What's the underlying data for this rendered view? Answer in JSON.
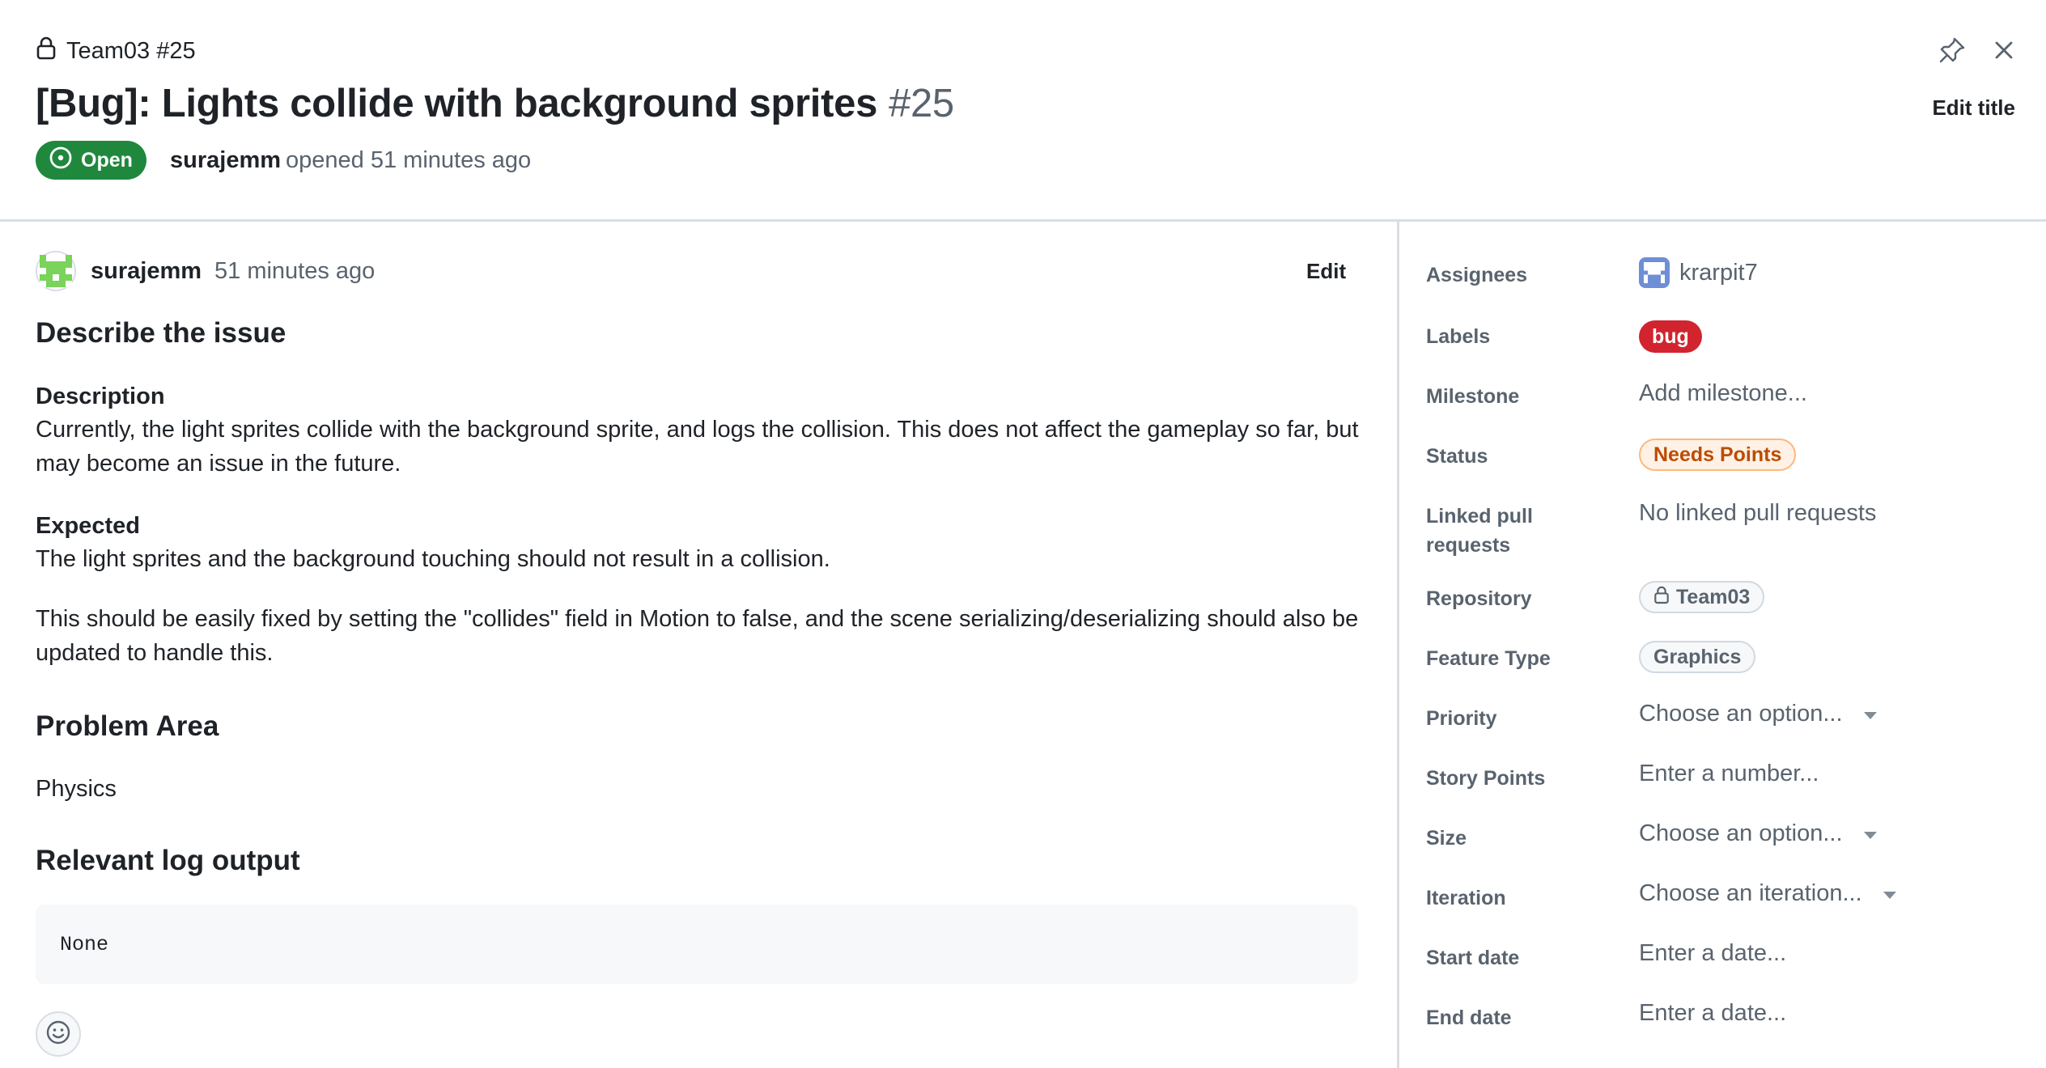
{
  "header": {
    "repo_ref": "Team03 #25",
    "title": "[Bug]: Lights collide with background sprites",
    "number": "#25",
    "state": "Open",
    "author": "surajemm",
    "opened_text": "opened 51 minutes ago",
    "edit_title": "Edit title"
  },
  "comment": {
    "author": "surajemm",
    "time": "51 minutes ago",
    "edit": "Edit"
  },
  "body": {
    "heading_describe": "Describe the issue",
    "description_label": "Description",
    "description_text": "Currently, the light sprites collide with the background sprite, and logs the collision. This does not affect the gameplay so far, but may become an issue in the future.",
    "expected_label": "Expected",
    "expected_text": "The light sprites and the background touching should not result in a collision.",
    "fix_text": "This should be easily fixed by setting the \"collides\" field in Motion to false, and the scene serializing/deserializing should also be updated to handle this.",
    "heading_problem_area": "Problem Area",
    "problem_area": "Physics",
    "heading_log": "Relevant log output",
    "log_output": "None"
  },
  "sidebar": {
    "assignees_label": "Assignees",
    "assignee": "krarpit7",
    "labels_label": "Labels",
    "label_bug": "bug",
    "milestone_label": "Milestone",
    "milestone_value": "Add milestone...",
    "status_label": "Status",
    "status_value": "Needs Points",
    "linked_label_line1": "Linked pull",
    "linked_label_line2": "requests",
    "linked_value": "No linked pull requests",
    "repository_label": "Repository",
    "repository_value": "Team03",
    "feature_type_label": "Feature Type",
    "feature_type_value": "Graphics",
    "priority_label": "Priority",
    "priority_value": "Choose an option...",
    "story_points_label": "Story Points",
    "story_points_value": "Enter a number...",
    "size_label": "Size",
    "size_value": "Choose an option...",
    "iteration_label": "Iteration",
    "iteration_value": "Choose an iteration...",
    "start_date_label": "Start date",
    "start_date_value": "Enter a date...",
    "end_date_label": "End date",
    "end_date_value": "Enter a date..."
  },
  "icons": [
    "lock-icon",
    "pin-icon",
    "close-icon",
    "issue-open-icon",
    "smiley-icon",
    "chevron-down-icon"
  ],
  "colors": {
    "open_green": "#1f883d",
    "bug_red": "#d1242f",
    "status_orange": "#bc4c00",
    "muted_text": "#59636e",
    "border": "#d8dee4"
  }
}
